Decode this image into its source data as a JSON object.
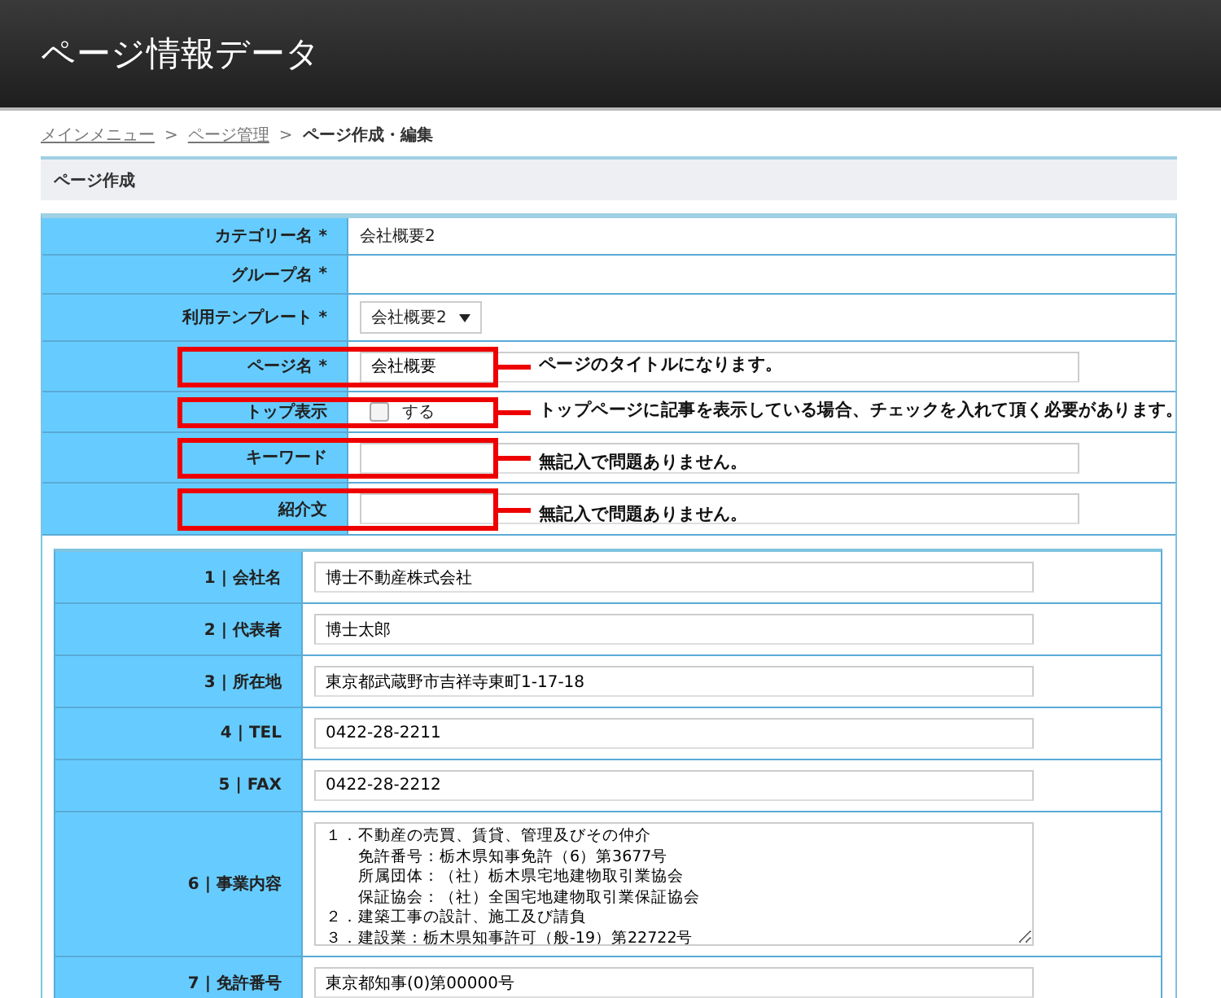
{
  "header": {
    "title": "ページ情報データ"
  },
  "breadcrumb": [
    {
      "kind": "link",
      "text": "メインメニュー"
    },
    {
      "kind": "separator",
      "text": ">"
    },
    {
      "kind": "link",
      "text": "ページ管理"
    },
    {
      "kind": "separator",
      "text": ">"
    },
    {
      "kind": "current",
      "text": "ページ作成・編集"
    }
  ],
  "section": {
    "title": "ページ作成"
  },
  "fields": [
    {
      "kind": "static",
      "label": "カテゴリー名",
      "required_mark": "*",
      "value": "会社概要2"
    },
    {
      "kind": "static",
      "label": "グループ名",
      "required_mark": "*"
    },
    {
      "kind": "select",
      "label": "利用テンプレート",
      "required_mark": "*",
      "value": "会社概要2"
    },
    {
      "kind": "text",
      "label": "ページ名",
      "required_mark": "*",
      "value": "会社概要",
      "annotation": "ページのタイトルになります。"
    },
    {
      "kind": "checkbox",
      "label": "トップ表示",
      "checked": false,
      "option": "する",
      "annotation": "トップページに記事を表示している場合、チェックを入れて頂く必要があります。"
    },
    {
      "kind": "text",
      "label": "キーワード",
      "annotation": "無記入で問題ありません。"
    },
    {
      "kind": "text",
      "label": "紹介文",
      "annotation": "無記入で問題ありません。"
    }
  ],
  "company_fields": [
    {
      "kind": "text",
      "label": "1 | 会社名",
      "value": "博士不動産株式会社"
    },
    {
      "kind": "text",
      "label": "2 | 代表者",
      "value": "博士太郎"
    },
    {
      "kind": "text",
      "label": "3 | 所在地",
      "value": "東京都武蔵野市吉祥寺東町1-17-18"
    },
    {
      "kind": "text",
      "label": "4 | TEL",
      "value": "0422-28-2211"
    },
    {
      "kind": "text",
      "label": "5 | FAX",
      "value": "0422-28-2212"
    },
    {
      "kind": "textarea",
      "label": "6 | 事業内容",
      "lines": [
        "１．不動産の売買、賃貸、管理及びその仲介",
        "　　免許番号：栃木県知事免許（6）第3677号",
        "　　所属団体：（社）栃木県宅地建物取引業協会",
        "　　保証協会：（社）全国宅地建物取引業保証協会",
        "２．建築工事の設計、施工及び請負",
        "３．建設業：栃木県知事許可（般-19）第22722号"
      ]
    },
    {
      "kind": "text",
      "label": "7 | 免許番号",
      "value": "東京都知事(0)第00000号"
    }
  ]
}
